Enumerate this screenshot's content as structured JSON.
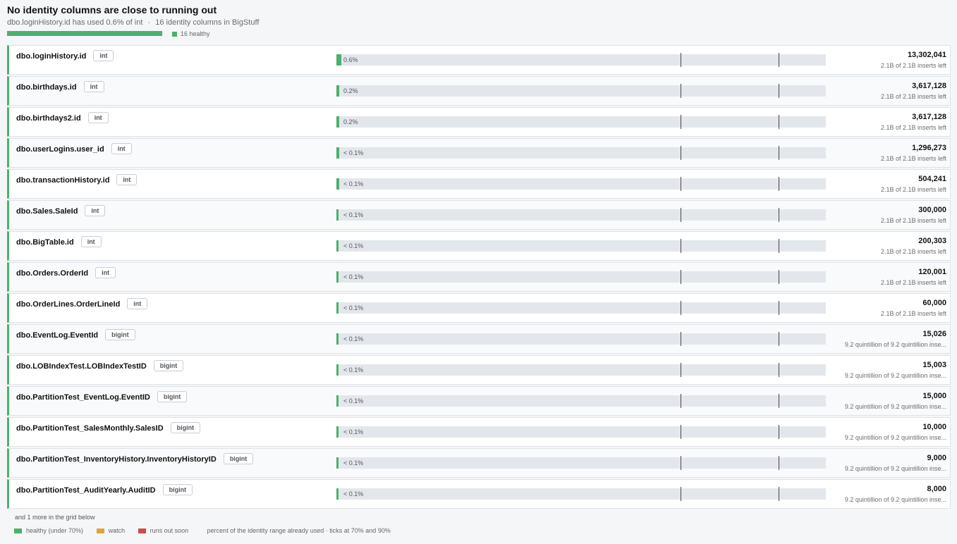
{
  "header": {
    "title": "No identity columns are close to running out",
    "subtitle_main": "dbo.loginHistory.id has used 0.6% of int",
    "subtitle_sep": "·",
    "subtitle_count": "16 identity columns in BigStuff",
    "summary_legend": "16 healthy",
    "summary_healthy_fraction": 1.0
  },
  "colors": {
    "healthy": "#4caf6e",
    "watch": "#e0a33a",
    "runs_out_soon": "#d04a4a",
    "track": "#e3e7ec"
  },
  "rows": [
    {
      "name": "dbo.loginHistory.id",
      "type": "int",
      "pct_label": "0.6%",
      "used_fraction": 0.006,
      "count": "13,302,041",
      "remaining": "2.1B of 2.1B inserts left"
    },
    {
      "name": "dbo.birthdays.id",
      "type": "int",
      "pct_label": "0.2%",
      "used_fraction": 0.002,
      "count": "3,617,128",
      "remaining": "2.1B of 2.1B inserts left"
    },
    {
      "name": "dbo.birthdays2.id",
      "type": "int",
      "pct_label": "0.2%",
      "used_fraction": 0.002,
      "count": "3,617,128",
      "remaining": "2.1B of 2.1B inserts left"
    },
    {
      "name": "dbo.userLogins.user_id",
      "type": "int",
      "pct_label": "< 0.1%",
      "used_fraction": 0.0006,
      "count": "1,296,273",
      "remaining": "2.1B of 2.1B inserts left"
    },
    {
      "name": "dbo.transactionHistory.id",
      "type": "int",
      "pct_label": "< 0.1%",
      "used_fraction": 0.0002,
      "count": "504,241",
      "remaining": "2.1B of 2.1B inserts left"
    },
    {
      "name": "dbo.Sales.SaleId",
      "type": "int",
      "pct_label": "< 0.1%",
      "used_fraction": 0.0001,
      "count": "300,000",
      "remaining": "2.1B of 2.1B inserts left"
    },
    {
      "name": "dbo.BigTable.id",
      "type": "int",
      "pct_label": "< 0.1%",
      "used_fraction": 0.0001,
      "count": "200,303",
      "remaining": "2.1B of 2.1B inserts left"
    },
    {
      "name": "dbo.Orders.OrderId",
      "type": "int",
      "pct_label": "< 0.1%",
      "used_fraction": 0.0001,
      "count": "120,001",
      "remaining": "2.1B of 2.1B inserts left"
    },
    {
      "name": "dbo.OrderLines.OrderLineId",
      "type": "int",
      "pct_label": "< 0.1%",
      "used_fraction": 0.0,
      "count": "60,000",
      "remaining": "2.1B of 2.1B inserts left"
    },
    {
      "name": "dbo.EventLog.EventId",
      "type": "bigint",
      "pct_label": "< 0.1%",
      "used_fraction": 0.0,
      "count": "15,026",
      "remaining": "9.2 quintillion of 9.2 quintillion inse..."
    },
    {
      "name": "dbo.LOBIndexTest.LOBIndexTestID",
      "type": "bigint",
      "pct_label": "< 0.1%",
      "used_fraction": 0.0,
      "count": "15,003",
      "remaining": "9.2 quintillion of 9.2 quintillion inse..."
    },
    {
      "name": "dbo.PartitionTest_EventLog.EventID",
      "type": "bigint",
      "pct_label": "< 0.1%",
      "used_fraction": 0.0,
      "count": "15,000",
      "remaining": "9.2 quintillion of 9.2 quintillion inse..."
    },
    {
      "name": "dbo.PartitionTest_SalesMonthly.SalesID",
      "type": "bigint",
      "pct_label": "< 0.1%",
      "used_fraction": 0.0,
      "count": "10,000",
      "remaining": "9.2 quintillion of 9.2 quintillion inse..."
    },
    {
      "name": "dbo.PartitionTest_InventoryHistory.InventoryHistoryID",
      "type": "bigint",
      "pct_label": "< 0.1%",
      "used_fraction": 0.0,
      "count": "9,000",
      "remaining": "9.2 quintillion of 9.2 quintillion inse..."
    },
    {
      "name": "dbo.PartitionTest_AuditYearly.AuditID",
      "type": "bigint",
      "pct_label": "< 0.1%",
      "used_fraction": 0.0,
      "count": "8,000",
      "remaining": "9.2 quintillion of 9.2 quintillion inse..."
    }
  ],
  "footer": {
    "more": "and 1 more in the grid below",
    "legend_healthy": "healthy (under 70%)",
    "legend_watch": "watch",
    "legend_runs_out": "runs out soon",
    "note": "percent of the identity range already used · ticks at 70% and 90%"
  }
}
